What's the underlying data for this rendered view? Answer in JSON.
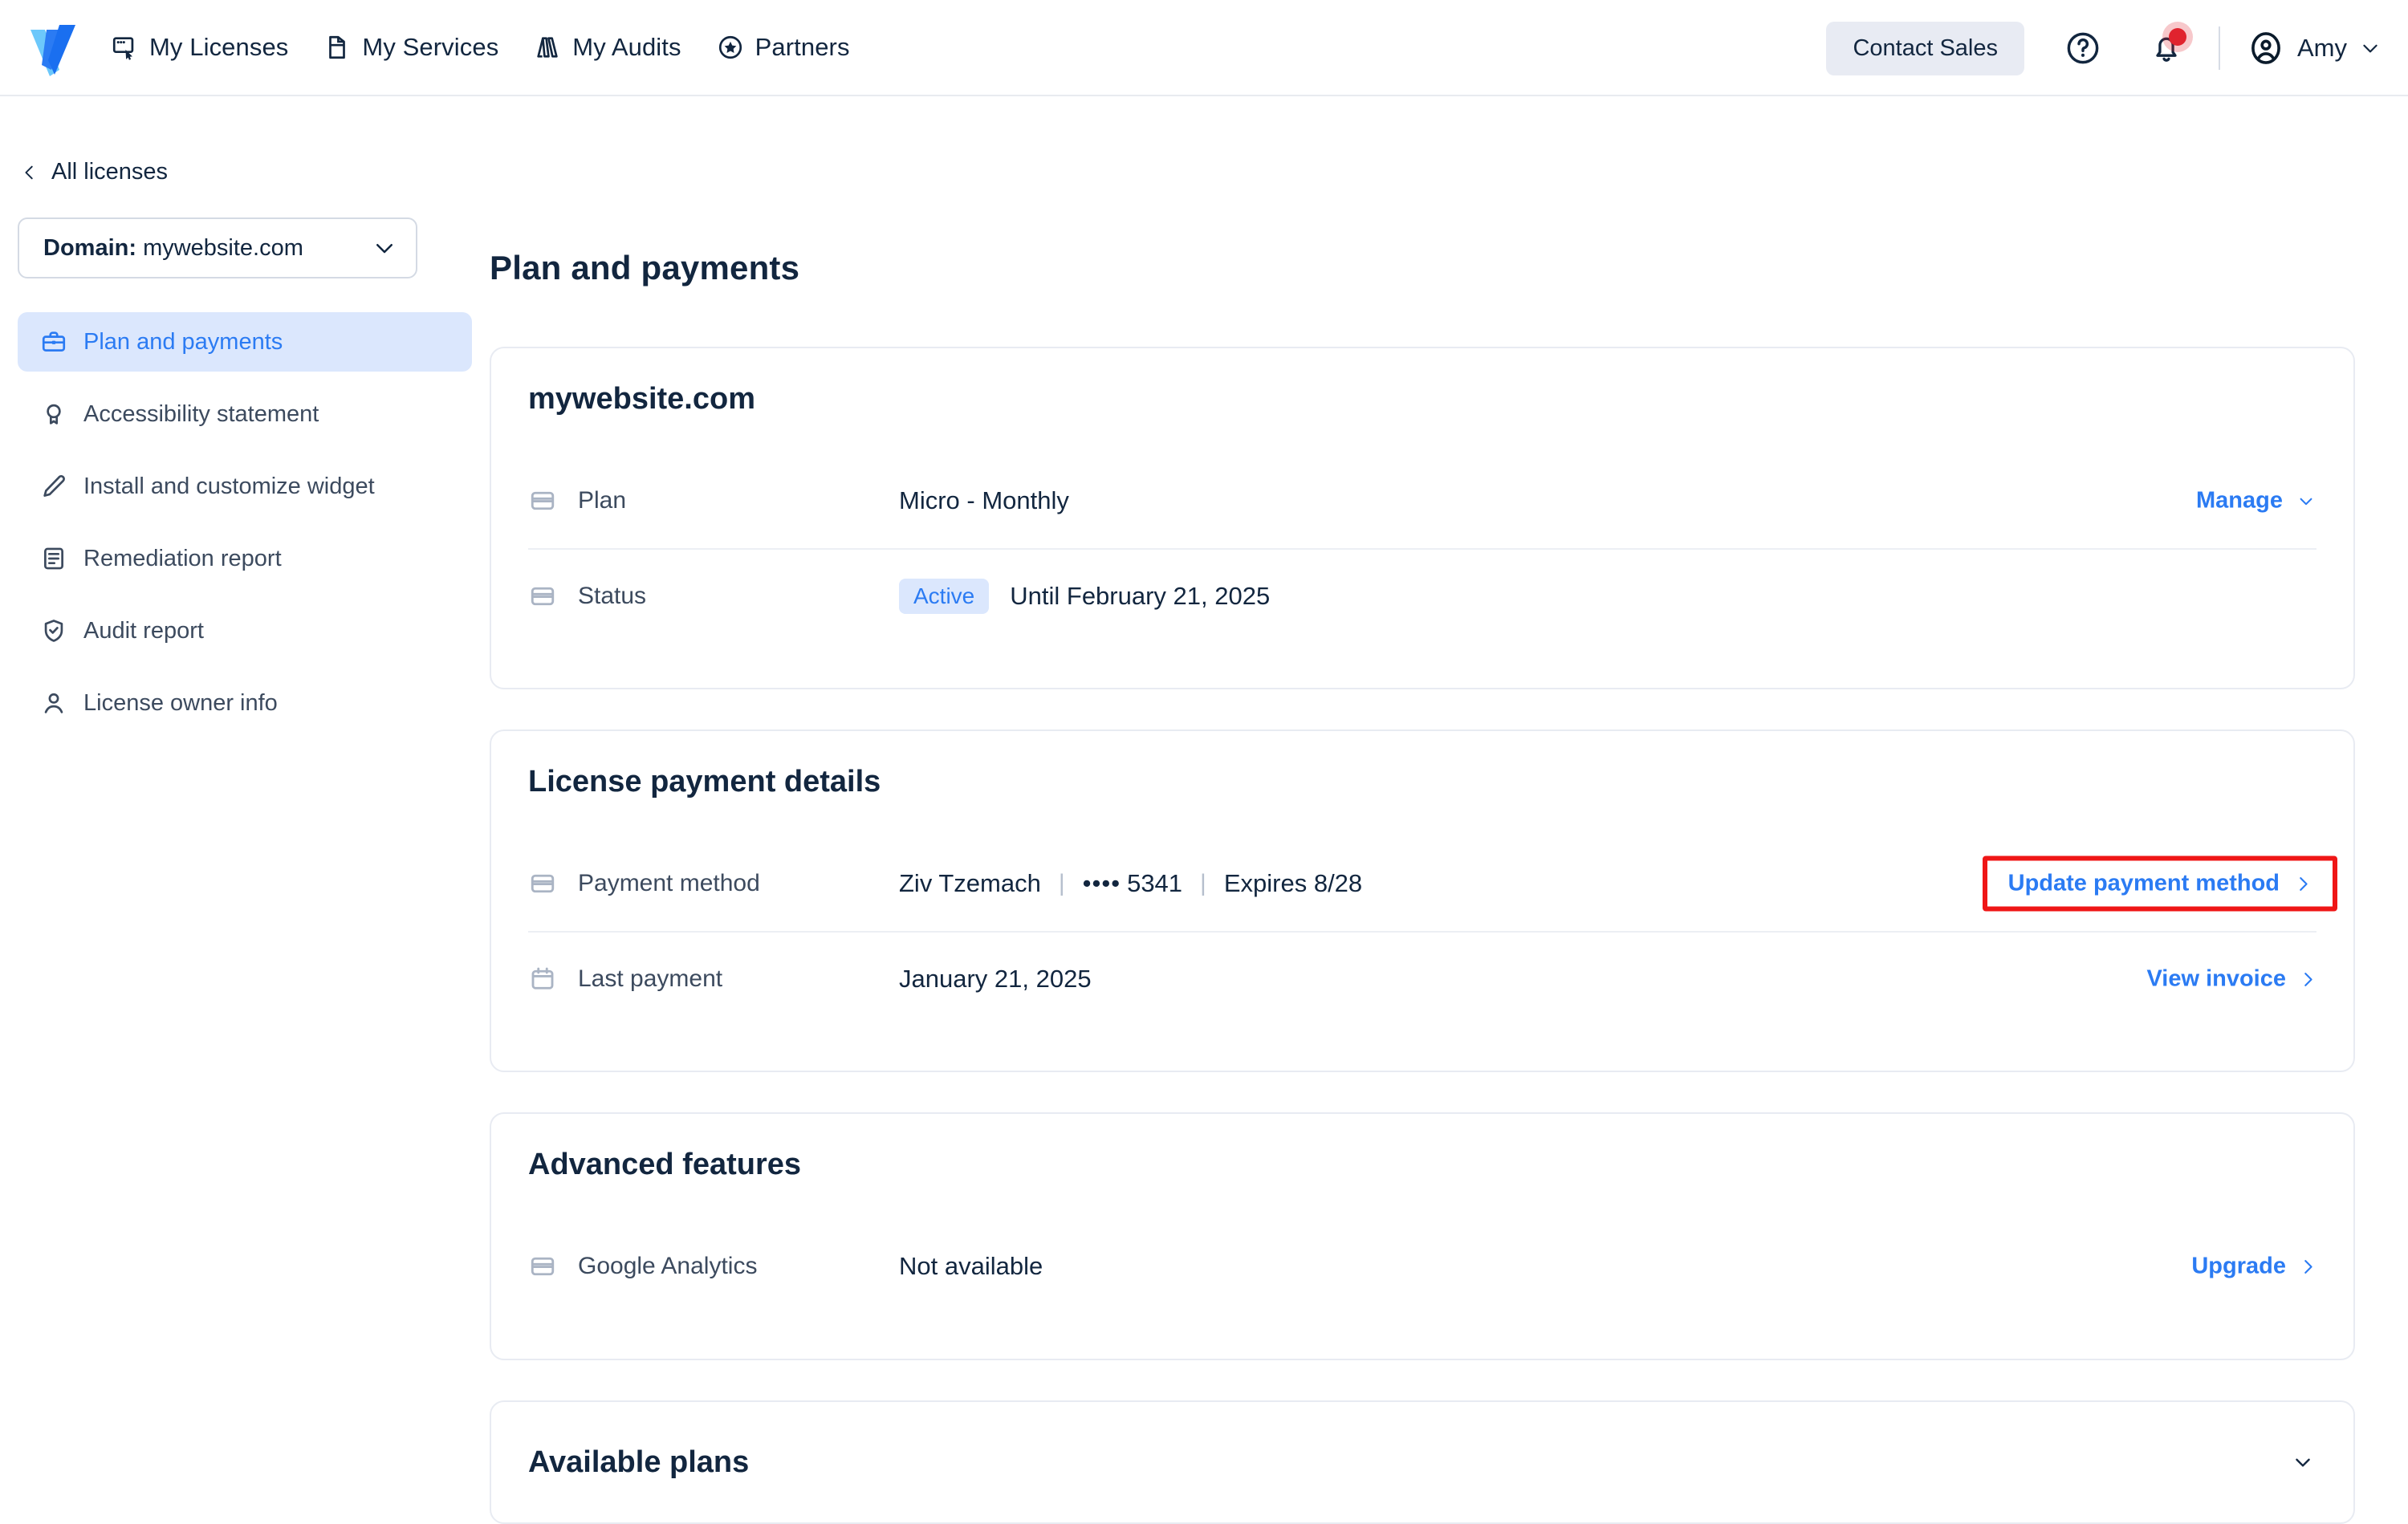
{
  "header": {
    "logo_name": "accessibe-logo",
    "nav": [
      {
        "label": "My Licenses",
        "icon": "licenses-icon"
      },
      {
        "label": "My Services",
        "icon": "services-icon"
      },
      {
        "label": "My Audits",
        "icon": "audits-icon"
      },
      {
        "label": "Partners",
        "icon": "star-circle-icon"
      }
    ],
    "contact_sales": "Contact Sales",
    "help_icon": "question-circle-icon",
    "notifications_icon": "bell-icon",
    "notifications_has_badge": true,
    "user_name": "Amy",
    "avatar_icon": "user-circle-icon"
  },
  "sidebar": {
    "back_label": "All licenses",
    "domain_prefix": "Domain:",
    "domain_value": "mywebsite.com",
    "items": [
      {
        "label": "Plan and payments",
        "icon": "briefcase-icon",
        "active": true
      },
      {
        "label": "Accessibility statement",
        "icon": "award-icon",
        "active": false
      },
      {
        "label": "Install and customize widget",
        "icon": "pencil-icon",
        "active": false
      },
      {
        "label": "Remediation report",
        "icon": "document-list-icon",
        "active": false
      },
      {
        "label": "Audit report",
        "icon": "shield-check-icon",
        "active": false
      },
      {
        "label": "License owner info",
        "icon": "person-icon",
        "active": false
      }
    ]
  },
  "main": {
    "page_title": "Plan and payments",
    "plan_card": {
      "title": "mywebsite.com",
      "rows": [
        {
          "label": "Plan",
          "value": "Micro - Monthly",
          "icon": "credit-card-icon",
          "action": "Manage",
          "action_icon": "chevron-down-icon"
        },
        {
          "label": "Status",
          "badge": "Active",
          "value": "Until February 21, 2025",
          "icon": "credit-card-icon"
        }
      ]
    },
    "payment_card": {
      "title": "License payment details",
      "payment_method": {
        "label": "Payment method",
        "icon": "credit-card-icon",
        "holder": "Ziv Tzemach",
        "card_dots": "••••",
        "card_last4": "5341",
        "expires": "Expires 8/28",
        "action": "Update payment method",
        "action_icon": "chevron-right-icon",
        "highlighted": true,
        "highlight_color": "#ef1616"
      },
      "last_payment": {
        "label": "Last payment",
        "icon": "calendar-icon",
        "value": "January 21, 2025",
        "action": "View invoice",
        "action_icon": "chevron-right-icon"
      }
    },
    "advanced_card": {
      "title": "Advanced features",
      "row": {
        "label": "Google Analytics",
        "icon": "credit-card-icon",
        "value": "Not available",
        "action": "Upgrade",
        "action_icon": "chevron-right-icon"
      }
    },
    "available_plans": {
      "title": "Available plans",
      "toggle_icon": "chevron-down-icon"
    }
  },
  "colors": {
    "accent_blue": "#2b7bf3",
    "badge_bg": "#dbe7fd",
    "text_dark": "#12263f",
    "text_muted": "#3c4a5e",
    "highlight_red": "#ef1616"
  }
}
